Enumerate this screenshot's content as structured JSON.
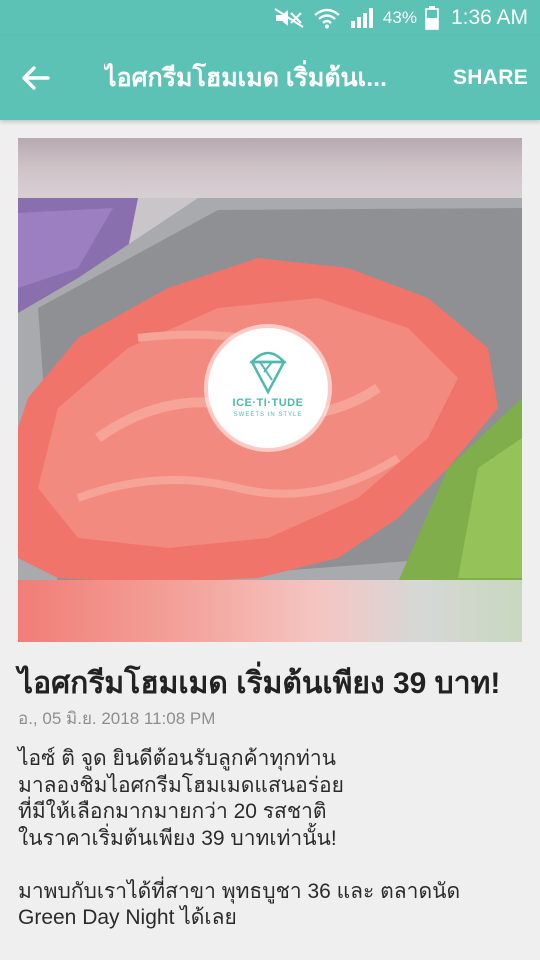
{
  "status_bar": {
    "battery_percent": "43%",
    "time": "1:36 AM",
    "icons": [
      "mute-icon",
      "wifi-icon",
      "signal-icon",
      "battery-icon"
    ]
  },
  "app_bar": {
    "back_icon": "arrow-left-icon",
    "title": "ไอศกรีมโฮมเมด เริ่มต้นเ...",
    "share_label": "SHARE",
    "color": "#5cc2b5"
  },
  "hero_image": {
    "logo_name": "ICE·TI·TUDE",
    "logo_tagline": "SWEETS IN STYLE",
    "logo_color": "#4fb9ad"
  },
  "article": {
    "title": "ไอศกรีมโฮมเมด เริ่มต้นเพียง 39 บาท!",
    "date": "อ., 05 มิ.ย. 2018 11:08 PM",
    "paragraph1": [
      "ไอซ์ ติ จูด ยินดีต้อนรับลูกค้าทุกท่าน",
      "มาลองชิมไอศกรีมโฮมเมดแสนอร่อย",
      "ที่มีให้เลือกมากมายกว่า 20 รสชาติ",
      "ในราคาเริ่มต้นเพียง 39 บาทเท่านั้น!"
    ],
    "paragraph2": [
      "มาพบกับเราได้ที่สาขา พุทธบูชา 36 และ ตลาดนัด",
      "Green Day Night ได้เลย"
    ]
  }
}
